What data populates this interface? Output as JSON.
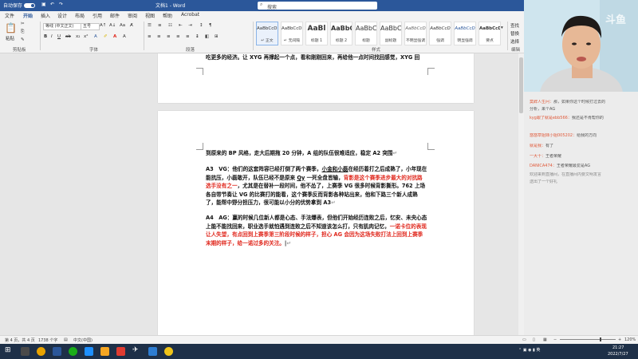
{
  "titlebar": {
    "autosave": "自动保存",
    "doc_title": "文档1 - Word",
    "search_placeholder": "搜索"
  },
  "tabs": [
    "文件",
    "开始",
    "插入",
    "设计",
    "布局",
    "引用",
    "邮件",
    "审阅",
    "视图",
    "帮助",
    "Acrobat"
  ],
  "ribbon": {
    "clipboard": {
      "paste": "粘贴",
      "label": "剪贴板"
    },
    "font": {
      "name": "等线 (中文正文)",
      "size": "五号",
      "label": "字体"
    },
    "paragraph": {
      "label": "段落"
    },
    "styles": {
      "label": "样式",
      "items": [
        {
          "preview": "AaBbCcDı",
          "name": "↵ 正文"
        },
        {
          "preview": "AaBbCcDı",
          "name": "↵ 无间隔"
        },
        {
          "preview": "AaBl",
          "name": "标题 1"
        },
        {
          "preview": "AaBbC",
          "name": "标题 2"
        },
        {
          "preview": "AaBbC",
          "name": "标题"
        },
        {
          "preview": "AaBbC",
          "name": "副标题"
        },
        {
          "preview": "AaBbCcD",
          "name": "不明显强调"
        },
        {
          "preview": "AaBbCcD",
          "name": "强调"
        },
        {
          "preview": "AaBbCcD",
          "name": "明显强调"
        },
        {
          "preview": "AaBbCcD",
          "name": "要点"
        }
      ]
    },
    "editing": {
      "find": "查找",
      "replace": "替换",
      "select": "选择",
      "label": "编辑"
    }
  },
  "document": {
    "page1_line": "吃更多的经济。让 XYG 再撑起一个点，看和刚刚回来，再给他一点时间找回感觉，XYG 回",
    "page2": {
      "line0": "到原来的 BP 风格，走大后期拖 20 分钟，A 组的队伍很难适应，稳定 A2 突围",
      "a3_intro": "A3　VG：他们的这套阵容已经打倒了两个赛季，",
      "a3_ul": "小金和小磊",
      "a3_mid": "在经历着打之后成熟了，小年现在能抗压，小磊敢开，队伍已经不是原来 ",
      "a3_qy": "Qy",
      "a3_mid2": " 一死全盘皆输，",
      "a3_red": "背影是这个赛季进步最大的对抗路选手没有之一",
      "a3_rest": "，尤其是在替补一段时间，他不怂了，上赛季 VG 很多时候背影撕形。762 上场各自带节奏让 VG 的比赛打的能看，这个赛季反而背影各种站出来，他和下路三个新人成熟了，能帮中野分担压力，很可能以小分的优势拿到 A3",
      "a4_intro": "A4　AG：赢的时候几位新人都是心态、手法爆表，但他们开始经历连败之后，忆安、未央心态上能不能找回来，职业选手就怕遇到连败之后不知道该怎么打，只有肌肉记忆，",
      "a4_red": "一诺卡位的表现让人失望，有点回到上赛季第三阶段时候的样子，担心 AG 会因为这场失败打法上回到上赛季末期的样子，给一诺过多的关注。"
    }
  },
  "statusbar": {
    "page": "第 4 页，共 4 页",
    "words": "1738 个字",
    "lang": "中文(中国)",
    "zoom": "120%"
  },
  "taskbar": {
    "time": "21:27",
    "date": "2022/7/27"
  },
  "stream": {
    "watermark": "斗鱼",
    "chat": [
      {
        "user": "莫辞人生问：",
        "text": "那，如果你这个时候打过去的"
      },
      {
        "user": "",
        "text": "分析，来个AG"
      },
      {
        "user": "kyg跟了就是ebb566：",
        "text": "我还是不肯帮你的"
      },
      {
        "user": "",
        "text": ""
      },
      {
        "user": "悠悠草姐妹小姐005202：",
        "text": "给我的方向"
      },
      {
        "user": "就是我：",
        "text": "有了"
      },
      {
        "user": "一大十：",
        "text": "王者荣耀"
      },
      {
        "user": "DANICA474：",
        "text": "王者荣耀最爱是AG"
      },
      {
        "user": "",
        "text": "欢迎来到直播间，在直播间内要文明发言"
      },
      {
        "user": "",
        "text": "送出了一个好礼"
      }
    ]
  }
}
